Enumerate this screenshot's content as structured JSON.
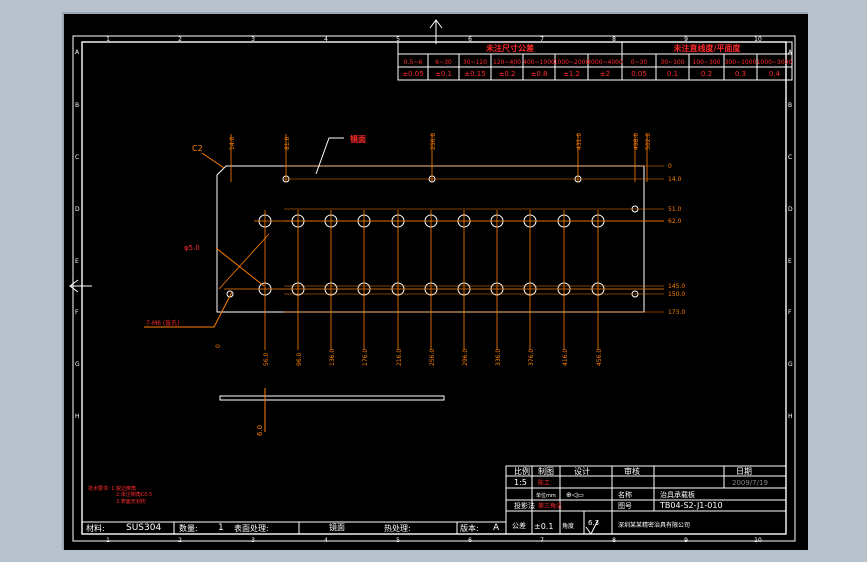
{
  "border": {
    "cols": [
      "1",
      "2",
      "3",
      "4",
      "5",
      "6",
      "7",
      "8",
      "9",
      "10"
    ],
    "rows": [
      "A",
      "B",
      "C",
      "D",
      "E",
      "F",
      "G",
      "H"
    ]
  },
  "tolerance_table": {
    "dim_header": "未注尺寸公差",
    "flat_header": "未注直线度/平面度",
    "dim_ranges": [
      "0.5~6",
      "6~30",
      "30~120",
      "120~400",
      "400~1000",
      "1000~2000",
      "2000~4000"
    ],
    "dim_tols": [
      "±0.05",
      "±0.1",
      "±0.15",
      "±0.2",
      "±0.8",
      "±1.2",
      "±2"
    ],
    "flat_ranges": [
      "0~30",
      "30~100",
      "100~300",
      "300~1000",
      "1000~3000"
    ],
    "flat_tols": [
      "0.05",
      "0.1",
      "0.2",
      "0.3",
      "0.4"
    ]
  },
  "part": {
    "chamfer_label": "C2",
    "hole_note": "φ5.0",
    "surface_label": "镜面",
    "tap_note": "7-M6 (盲孔)",
    "top_dims": [
      "14.0",
      "81.0",
      "256.0",
      "431.0",
      "498.0",
      "502.0"
    ],
    "right_dims": [
      "0",
      "14.0",
      "51.0",
      "62.0",
      "145.0",
      "150.0",
      "173.0"
    ],
    "bottom_dims": [
      "0",
      "56.0",
      "96.0",
      "136.0",
      "176.0",
      "216.0",
      "256.0",
      "296.0",
      "336.0",
      "376.0",
      "416.0",
      "456.0"
    ],
    "side_dim": "6.0"
  },
  "notes": {
    "l1": "技术要求: 1.锐边倒角",
    "l2": "2.未注倒角C0.5",
    "l3": "3.表面无划伤"
  },
  "title_block": {
    "h_scale": "比例",
    "h_draw": "制图",
    "h_design": "设计",
    "h_check": "审核",
    "h_date": "日期",
    "scale": "1:5",
    "drawer": "陈工",
    "date": "2009/7/19",
    "part_name_label": "名称",
    "part_name": "治具承载板",
    "drawing_no_label": "图号",
    "drawing_no": "TB04-S2-J1-010",
    "material_label": "材料:",
    "material": "SUS304",
    "qty_label": "数量:",
    "qty": "1",
    "surface_label": "表面处理:",
    "surface": "镜面",
    "heat_label": "热处理:",
    "version_label": "版本:",
    "version": "A",
    "tolerance_label": "公差",
    "tolerance": "±0.1",
    "angle_label": "角度",
    "roughness": "6.3",
    "company": "深圳某某精密治具有限公司",
    "unit_note": "单位mm",
    "projection_label": "投影法",
    "proj_note": "第三角法"
  },
  "colors": {
    "background": "#000000",
    "frame": "#ffffff",
    "dimension": "#ff7f00",
    "annotation_red": "#ff2a2a",
    "part": "#ffffff",
    "table_text": "#ff2a2a",
    "title_text": "#ffff00"
  }
}
